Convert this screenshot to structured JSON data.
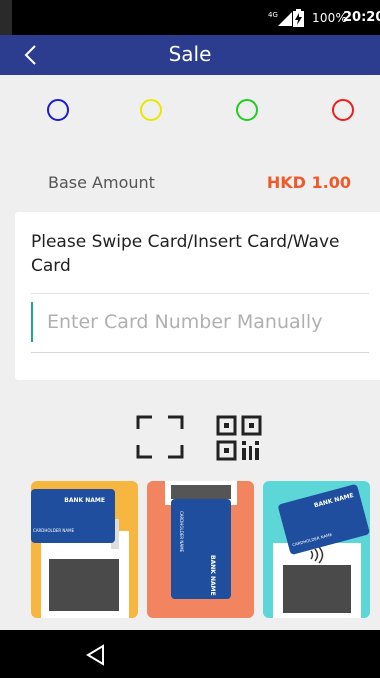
{
  "status_bar": {
    "network": "4G",
    "battery": "100%",
    "time": "20:20"
  },
  "app_bar": {
    "title": "Sale"
  },
  "indicators": [
    {
      "color": "#1c1cd0"
    },
    {
      "color": "#e8e800"
    },
    {
      "color": "#22cc22"
    },
    {
      "color": "#ee1c1c"
    }
  ],
  "amount": {
    "label": "Base Amount",
    "value": "HKD 1.00"
  },
  "card_entry": {
    "prompt": "Please Swipe Card/Insert Card/Wave Card",
    "placeholder": "Enter Card Number Manually"
  },
  "icons": {
    "scan": "scan-frame-icon",
    "qr": "qr-code-icon"
  },
  "methods": [
    {
      "name": "swipe",
      "bg": "#f7b640",
      "card_text": "BANK NAME",
      "holder": "CARDHOLDER NAME"
    },
    {
      "name": "insert",
      "bg": "#f2855f",
      "card_text": "BANK NAME",
      "holder": "CARDHOLDER NAME"
    },
    {
      "name": "tap",
      "bg": "#5dd6d8",
      "card_text": "BANK NAME",
      "holder": "CARDHOLDER NAME"
    }
  ]
}
